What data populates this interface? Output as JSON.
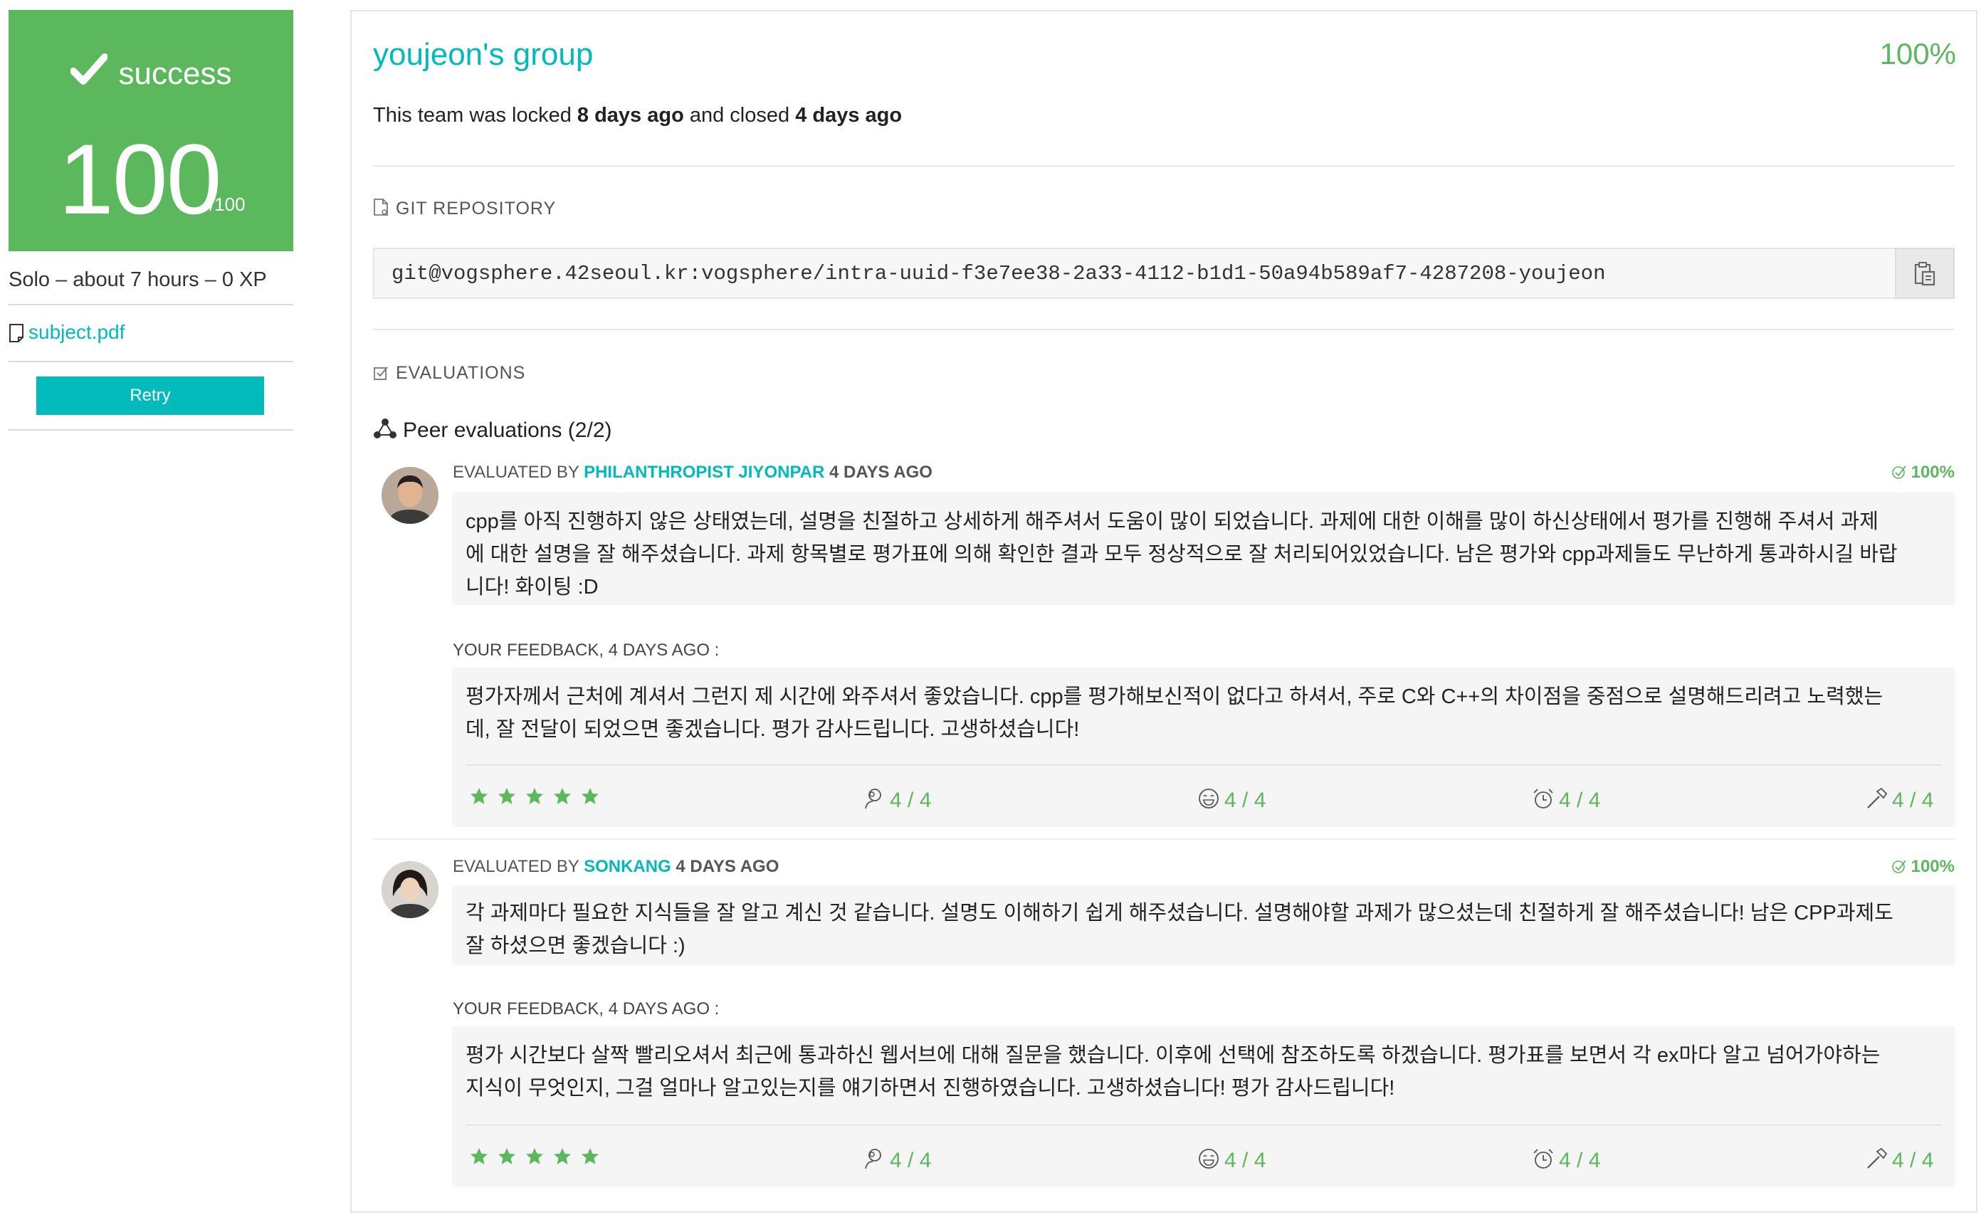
{
  "sidebar": {
    "status_label": "success",
    "score": "100",
    "score_max": "/100",
    "meta": "Solo – about 7 hours – 0 XP",
    "subject_link": "subject.pdf",
    "retry_label": "Retry",
    "status_color": "#5cb85c"
  },
  "team": {
    "name": "youjeon's group",
    "percent": "100%",
    "lock_prefix": "This team was locked ",
    "locked_ago": "8 days ago",
    "lock_middle": " and closed ",
    "closed_ago": "4 days ago"
  },
  "repository": {
    "section_title": "GIT REPOSITORY",
    "url": "git@vogsphere.42seoul.kr:vogsphere/intra-uuid-f3e7ee38-2a33-4112-b1d1-50a94b589af7-4287208-youjeon"
  },
  "evaluations": {
    "section_title": "EVALUATIONS",
    "peer_title": "Peer evaluations (2/2)",
    "items": [
      {
        "evaluated_by_label": "EVALUATED BY ",
        "login": "PHILANTHROPIST JIYONPAR",
        "ago": " 4 DAYS AGO",
        "percent": "100%",
        "comment_lines": [
          "cpp를 아직 진행하지 않은 상태였는데, 설명을 친절하고 상세하게 해주셔서 도움이 많이 되었습니다. 과제에 대한 이해를 많이 하신상태에서 평가를 진행해 주셔서 과제",
          "에 대한 설명을 잘 해주셨습니다. 과제 항목별로 평가표에 의해 확인한 결과 모두 정상적으로 잘 처리되어있었습니다. 남은 평가와 cpp과제들도 무난하게 통과하시길 바랍",
          "니다! 화이팅 :D"
        ],
        "feedback_label": "YOUR FEEDBACK, 4 DAYS AGO :",
        "feedback_lines": [
          "평가자께서 근처에 계셔서 그런지 제 시간에 와주셔서 좋았습니다. cpp를 평가해보신적이 없다고 하셔서, 주로 C와 C++의 차이점을 중점으로 설명해드리려고 노력했는",
          "데, 잘 전달이 되었으면 좋겠습니다. 평가 감사드립니다. 고생하셨습니다!"
        ],
        "ratings": {
          "interested": "4 / 4",
          "friendly": "4 / 4",
          "punctuality": "4 / 4",
          "rigorous": "4 / 4"
        },
        "stars": 5
      },
      {
        "evaluated_by_label": "EVALUATED BY ",
        "login": "SONKANG",
        "ago": " 4 DAYS AGO",
        "percent": "100%",
        "comment_lines": [
          "각 과제마다 필요한 지식들을 잘 알고 계신 것 같습니다. 설명도 이해하기 쉽게 해주셨습니다. 설명해야할 과제가 많으셨는데 친절하게 잘 해주셨습니다! 남은 CPP과제도",
          "잘 하셨으면 좋겠습니다 :)"
        ],
        "feedback_label": "YOUR FEEDBACK, 4 DAYS AGO :",
        "feedback_lines": [
          "평가 시간보다 살짝 빨리오셔서 최근에 통과하신 웹서브에 대해 질문을 했습니다. 이후에 선택에 참조하도록 하겠습니다. 평가표를 보면서 각 ex마다 알고 넘어가야하는",
          "지식이 무엇인지, 그걸 얼마나 알고있는지를 얘기하면서 진행하였습니다. 고생하셨습니다! 평가 감사드립니다!"
        ],
        "ratings": {
          "interested": "4 / 4",
          "friendly": "4 / 4",
          "punctuality": "4 / 4",
          "rigorous": "4 / 4"
        },
        "stars": 5
      }
    ]
  },
  "colors": {
    "accent": "#00babc",
    "success": "#5cb85c"
  }
}
